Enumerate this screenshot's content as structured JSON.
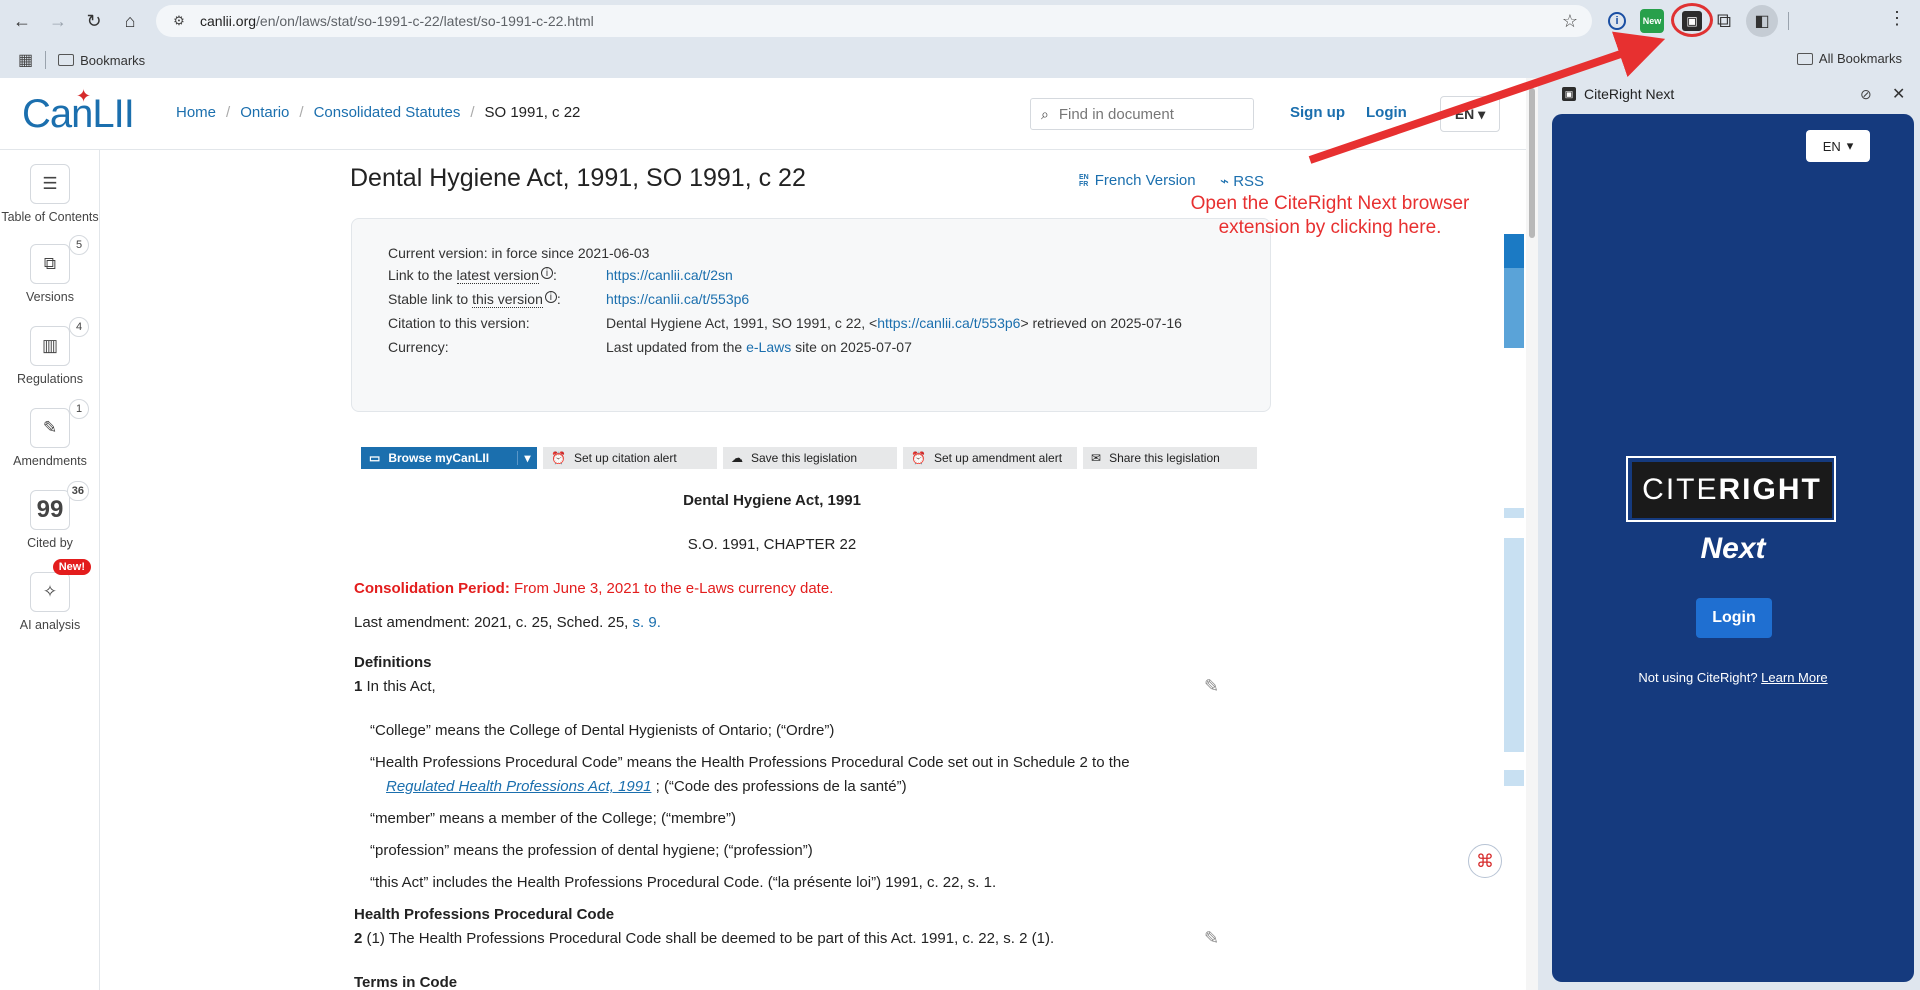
{
  "browser": {
    "url_host": "canlii.org",
    "url_path": "/en/on/laws/stat/so-1991-c-22/latest/so-1991-c-22.html",
    "bookmarks_folder": "Bookmarks",
    "all_bookmarks": "All Bookmarks",
    "ext_new_label": "New"
  },
  "header": {
    "logo": "CanLII",
    "breadcrumb": [
      "Home",
      "Ontario",
      "Consolidated Statutes",
      "SO 1991, c 22"
    ],
    "find_placeholder": "Find in document",
    "signup": "Sign up",
    "login": "Login",
    "lang": "EN"
  },
  "leftbar": {
    "items": [
      {
        "label": "Table of Contents",
        "icon": "list-icon",
        "badge": ""
      },
      {
        "label": "Versions",
        "icon": "versions-icon",
        "badge": "5"
      },
      {
        "label": "Regulations",
        "icon": "chart-icon",
        "badge": "4"
      },
      {
        "label": "Amendments",
        "icon": "document-edit-icon",
        "badge": "1"
      },
      {
        "label": "Cited by",
        "icon": "quote-icon",
        "badge": "36"
      },
      {
        "label": "AI analysis",
        "icon": "sparkle-icon",
        "badge": "New!"
      }
    ]
  },
  "document": {
    "title": "Dental Hygiene Act, 1991, SO 1991, c 22",
    "french_version": "French Version",
    "rss": "RSS",
    "info": {
      "current_version_label": "Current version: in force since 2021-06-03",
      "latest_label_pre": "Link to the ",
      "latest_label_link": "latest version",
      "latest_url": "https://canlii.ca/t/2sn",
      "stable_label_pre": "Stable link to ",
      "stable_label_link": "this version",
      "stable_url": "https://canlii.ca/t/553p6",
      "citation_label": "Citation to this version:",
      "citation_pre": "Dental Hygiene Act, 1991, SO 1991, c 22, <",
      "citation_url": "https://canlii.ca/t/553p6",
      "citation_post": "> retrieved on 2025-07-16",
      "currency_label": "Currency:",
      "currency_pre": "Last updated from the ",
      "currency_link": "e-Laws",
      "currency_post": " site on 2025-07-07"
    },
    "actions": {
      "browse": "Browse myCanLII",
      "citation_alert": "Set up citation alert",
      "save": "Save this legislation",
      "amendment_alert": "Set up amendment alert",
      "share": "Share this legislation"
    },
    "act_name": "Dental Hygiene Act, 1991",
    "chapter": "S.O. 1991, CHAPTER 22",
    "consolidation_label": "Consolidation Period:",
    "consolidation_text": " From June 3, 2021 to the ",
    "consolidation_link": "e-Laws currency date",
    "last_amendment": "Last amendment: 2021, c. 25, Sched. 25, ",
    "last_amendment_link": "s. 9",
    "definitions_heading": "Definitions",
    "s1_num": "1",
    "s1_text": " In this Act,",
    "def_college": "“College” means the College of Dental Hygienists of Ontario; (“Ordre”)",
    "def_hppc_1": "“Health Professions Procedural Code” means the Health Professions Procedural Code set out in Schedule 2 to the",
    "def_hppc_link": "Regulated Health Professions Act, 1991",
    "def_hppc_2": " ; (“Code des professions de la santé”)",
    "def_member": "“member” means a member of the College; (“membre”)",
    "def_profession": "“profession” means the profession of dental hygiene; (“profession”)",
    "def_this_act": "“this Act” includes the Health Professions Procedural Code. (“la présente loi”)  1991, c. 22, s. 1.",
    "hppc_heading": "Health Professions Procedural Code",
    "s2_num": "2",
    "s2_text": " (1) The Health Professions Procedural Code shall be deemed to be part of this Act.  1991, c. 22, s. 2 (1).",
    "terms_heading": "Terms in Code"
  },
  "annotation": {
    "text": "Open the CiteRight Next browser extension by clicking here."
  },
  "side_panel": {
    "title": "CiteRight Next",
    "lang": "EN",
    "logo_left": "CITE",
    "logo_right": "RIGHT",
    "next": "Next",
    "login": "Login",
    "note": "Not using CiteRight? ",
    "learn_more": "Learn More"
  },
  "colors": {
    "brand": "#1b6fae",
    "panel": "#153a7e",
    "annotation": "#e73030"
  }
}
